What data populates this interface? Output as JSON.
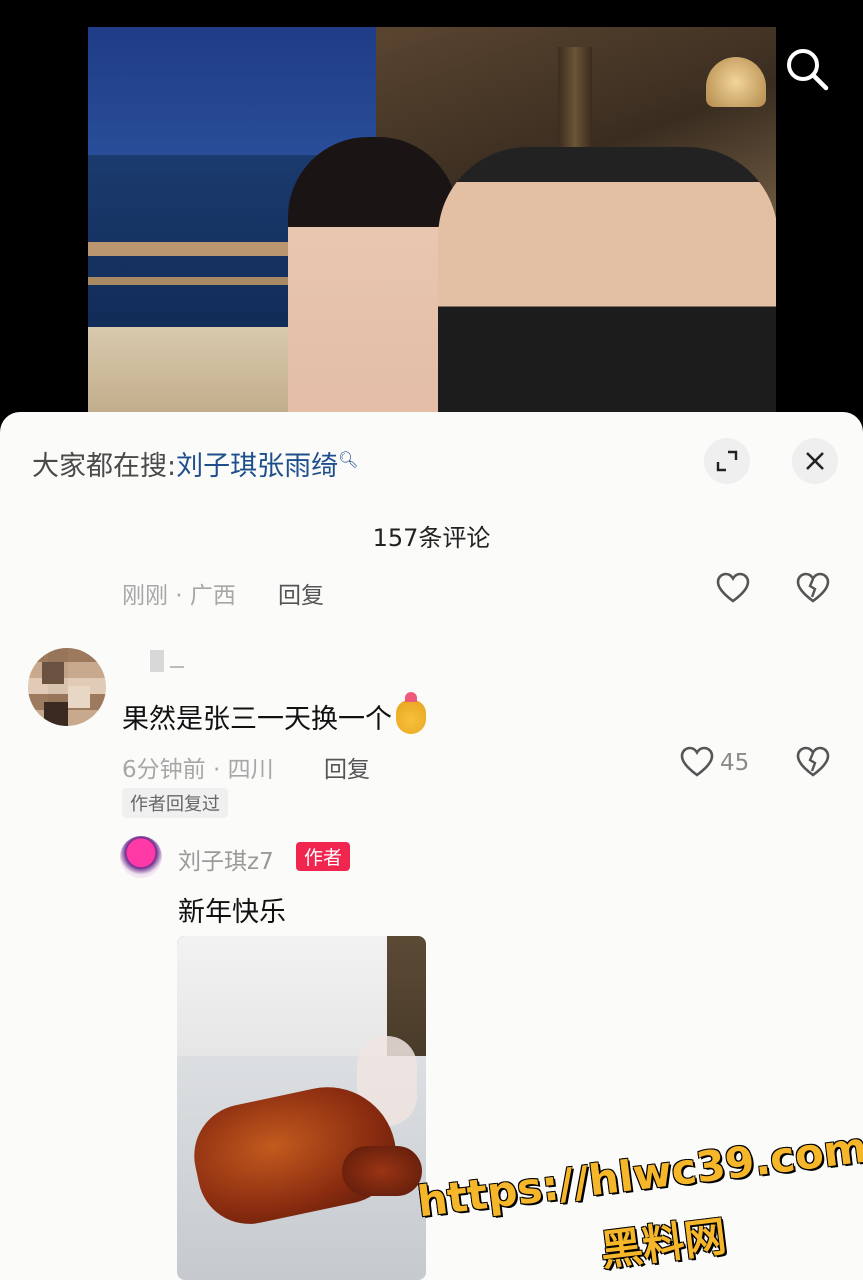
{
  "search_bar": {
    "prefix": "大家都在搜:",
    "keyword": "刘子琪张雨绮",
    "icon": "search-small-icon"
  },
  "comments": {
    "count_label": "157条评论",
    "prev_meta": "刚刚 · 广西",
    "reply_label": "回复",
    "item": {
      "text": "果然是张三一天换一个",
      "emoji_icon": "heart-hands-emoji",
      "meta": "6分钟前 · 四川",
      "like_count": "45",
      "author_replied": "作者回复过"
    },
    "author_reply": {
      "name": "刘子琪z7",
      "badge": "作者",
      "text": "新年快乐"
    }
  },
  "watermark": {
    "url": "https://hlwc39.com",
    "site": "黑料网"
  },
  "colors": {
    "keyword": "#1e4f8c",
    "author_badge": "#f0264f",
    "watermark": "#f6b62a"
  }
}
